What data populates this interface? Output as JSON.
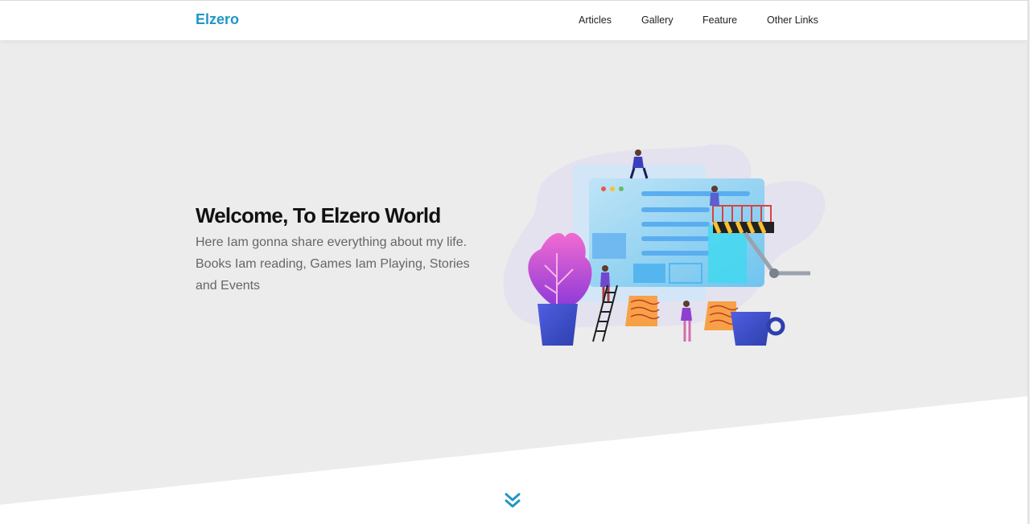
{
  "header": {
    "logo": "Elzero",
    "nav": [
      "Articles",
      "Gallery",
      "Feature",
      "Other Links"
    ]
  },
  "landing": {
    "title": "Welcome, To Elzero World",
    "description": "Here Iam gonna share everything about my life. Books Iam reading, Games Iam Playing, Stories and Events",
    "illustration_icon": "web-design-illustration-icon",
    "down_icon": "double-chevron-down-icon"
  },
  "colors": {
    "brand": "#2196c4",
    "landing_bg": "#ececec",
    "text": "#111111",
    "muted": "#666666"
  }
}
